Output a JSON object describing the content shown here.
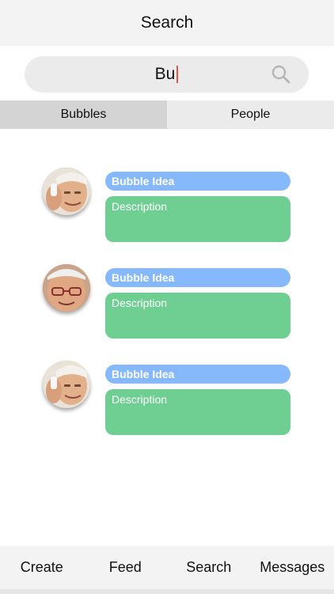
{
  "header": {
    "title": "Search"
  },
  "search": {
    "value": "Bu",
    "icon": "search-icon"
  },
  "tabs": [
    {
      "label": "Bubbles",
      "active": true
    },
    {
      "label": "People",
      "active": false
    }
  ],
  "bubbles": [
    {
      "title": "Bubble Idea",
      "description": "Description"
    },
    {
      "title": "Bubble Idea",
      "description": "Description"
    },
    {
      "title": "Bubble Idea",
      "description": "Description"
    }
  ],
  "nav": [
    {
      "label": "Create"
    },
    {
      "label": "Feed"
    },
    {
      "label": "Search"
    },
    {
      "label": "Messages"
    }
  ],
  "colors": {
    "title_pill": "#86b9fb",
    "description_box": "#6fcf93",
    "caret": "#e8524a",
    "header_bg": "#f3f3f3"
  }
}
